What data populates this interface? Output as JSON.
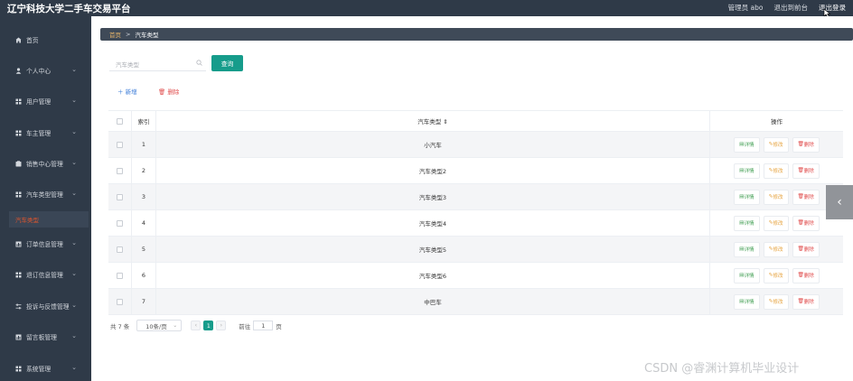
{
  "header": {
    "title": "辽宁科技大学二手车交易平台",
    "admin": "管理员 abo",
    "back_home": "退出到前台",
    "logout": "退出登录"
  },
  "sidebar": {
    "items": [
      {
        "label": "首页",
        "icon": "home-icon",
        "has_chevron": false
      },
      {
        "label": "个人中心",
        "icon": "user-icon",
        "has_chevron": true
      },
      {
        "label": "用户管理",
        "icon": "grid-icon",
        "has_chevron": true
      },
      {
        "label": "车主管理",
        "icon": "grid-icon",
        "has_chevron": true
      },
      {
        "label": "销售中心管理",
        "icon": "folder-icon",
        "has_chevron": true
      },
      {
        "label": "汽车类型管理",
        "icon": "grid-icon",
        "has_chevron": true
      },
      {
        "label": "订单信息管理",
        "icon": "chart-icon",
        "has_chevron": true
      },
      {
        "label": "退订信息管理",
        "icon": "grid-icon",
        "has_chevron": true
      },
      {
        "label": "投诉与反馈管理",
        "icon": "sliders-icon",
        "has_chevron": true
      },
      {
        "label": "留言板管理",
        "icon": "chart-icon",
        "has_chevron": true
      },
      {
        "label": "系统管理",
        "icon": "grid-icon",
        "has_chevron": true
      }
    ],
    "active_sub": "汽车类型"
  },
  "breadcrumb": {
    "home": "首页",
    "current": "汽车类型"
  },
  "search": {
    "placeholder": "汽车类型",
    "button": "查询"
  },
  "toolbar": {
    "add": "＋ 新增",
    "delete": "删除"
  },
  "table": {
    "headers": {
      "index": "索引",
      "type": "汽车类型 ⇕",
      "ops": "操作"
    },
    "rows": [
      {
        "index": "1",
        "type": "小汽车"
      },
      {
        "index": "2",
        "type": "汽车类型2"
      },
      {
        "index": "3",
        "type": "汽车类型3"
      },
      {
        "index": "4",
        "type": "汽车类型4"
      },
      {
        "index": "5",
        "type": "汽车类型5"
      },
      {
        "index": "6",
        "type": "汽车类型6"
      },
      {
        "index": "7",
        "type": "中巴车"
      }
    ],
    "op_labels": {
      "detail": "详情",
      "edit": "修改",
      "remove": "删除"
    }
  },
  "pagination": {
    "total": "共 7 条",
    "page_size": "10条/页",
    "current_page": "1",
    "goto_prefix": "前往",
    "goto_value": "1",
    "goto_suffix": "页"
  },
  "watermark": "CSDN @睿渊计算机毕业设计",
  "colors": {
    "sidebar": "#2f3a48",
    "primary": "#169c8b",
    "active_sub": "#e2552c"
  }
}
